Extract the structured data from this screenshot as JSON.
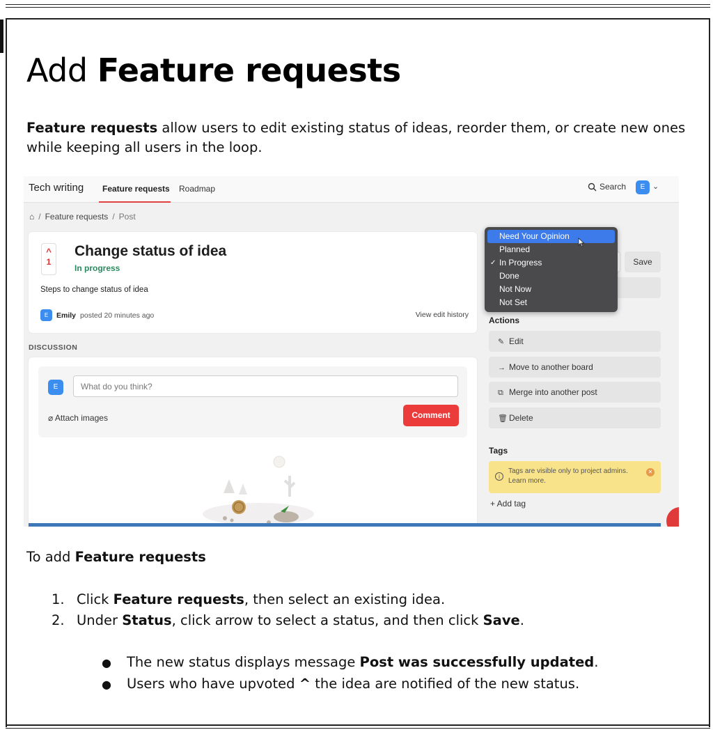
{
  "doc": {
    "title_prefix": "Add ",
    "title_bold": "Feature requests",
    "intro_bold": "Feature requests",
    "intro_rest": " allow users to edit existing status of ideas, reorder them, or create new ones while keeping all users in the loop.",
    "para2_prefix": "To add ",
    "para2_bold": "Feature requests",
    "steps": [
      {
        "num": "1.",
        "pre": "Click ",
        "bold": "Feature requests",
        "post": ", then select an existing idea.",
        "pre2": "",
        "bold2": "",
        "post2": ""
      },
      {
        "num": "2.",
        "pre": "Under ",
        "bold": "Status",
        "post": ", click arrow to select a status, and then click ",
        "pre2": "",
        "bold2": "Save",
        "post2": "."
      }
    ],
    "bullets": [
      {
        "pre": "The new status displays message ",
        "bold": "Post was successfully updated",
        "post": "."
      },
      {
        "pre": "Users who have upvoted ",
        "bold": "^",
        "post": " the idea are notified of the new status."
      }
    ]
  },
  "app": {
    "brand": "Tech writing",
    "tabs": [
      "Feature requests",
      "Roadmap"
    ],
    "search_label": "Search",
    "user_initial": "E",
    "breadcrumb": {
      "home": "⌂",
      "sep": "/",
      "section": "Feature requests",
      "current": "Post"
    },
    "post": {
      "votes": "1",
      "title": "Change status of idea",
      "status": "In progress",
      "body": "Steps to change status of idea",
      "author": "Emily",
      "posted": "posted 20 minutes ago",
      "history": "View edit history"
    },
    "discussion": {
      "label": "DISCUSSION",
      "placeholder": "What do you think?",
      "attach": "Attach images",
      "comment_button": "Comment"
    },
    "sidebar": {
      "save": "Save",
      "actions_label": "Actions",
      "actions": [
        {
          "icon": "✎",
          "label": "Edit"
        },
        {
          "icon": "→",
          "label": "Move to another board"
        },
        {
          "icon": "⧉",
          "label": "Merge into another post"
        },
        {
          "icon": "🗑",
          "label": "Delete"
        }
      ],
      "tags_label": "Tags",
      "tags_note": "Tags are visible only to project admins. Learn more.",
      "add_tag": "+ Add tag"
    },
    "status_dropdown": {
      "options": [
        "Need Your Opinion",
        "Planned",
        "In Progress",
        "Done",
        "Not Now",
        "Not Set"
      ],
      "checked": "In Progress",
      "highlighted": "Need Your Opinion"
    }
  },
  "colors": {
    "accent_red": "#ec3b3b",
    "status_green": "#2a8a5e",
    "avatar_blue": "#3b8ef0",
    "dropdown_bg": "#4a4a4d",
    "dropdown_highlight": "#3d7bea",
    "tags_note_bg": "#f8e38a"
  }
}
